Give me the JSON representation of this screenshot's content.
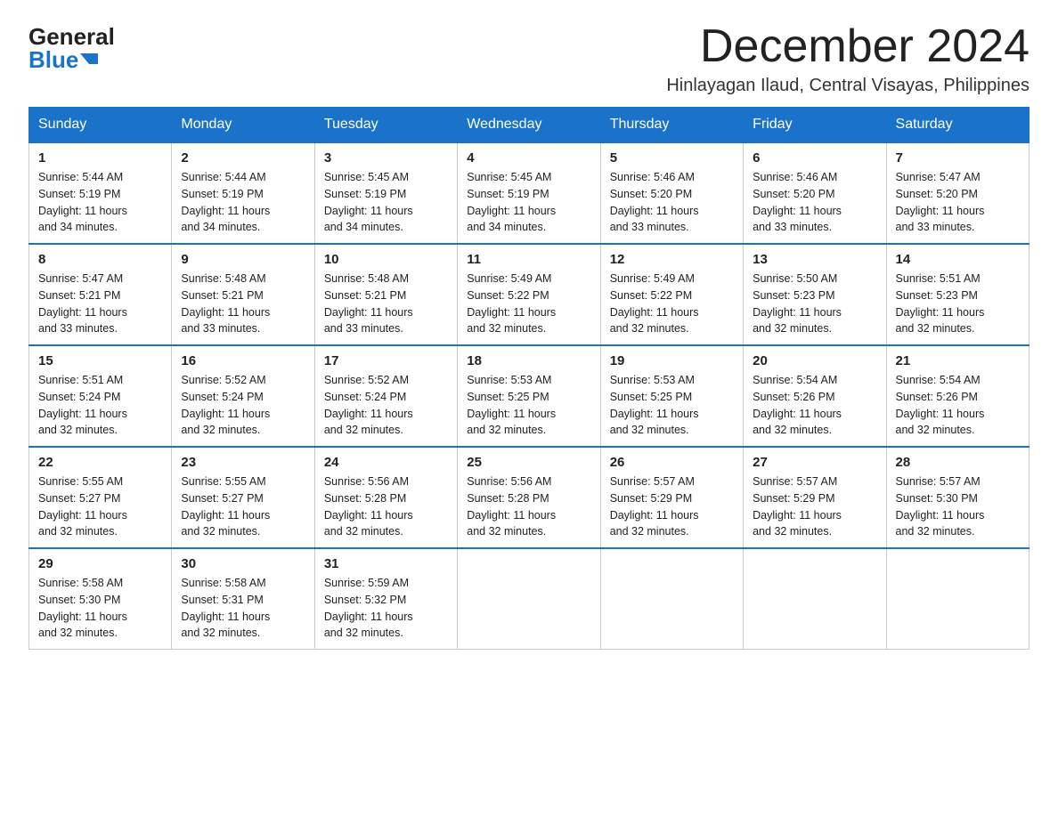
{
  "logo": {
    "general": "General",
    "blue": "Blue"
  },
  "title": "December 2024",
  "subtitle": "Hinlayagan Ilaud, Central Visayas, Philippines",
  "days_of_week": [
    "Sunday",
    "Monday",
    "Tuesday",
    "Wednesday",
    "Thursday",
    "Friday",
    "Saturday"
  ],
  "weeks": [
    [
      {
        "day": "1",
        "sunrise": "5:44 AM",
        "sunset": "5:19 PM",
        "daylight": "11 hours and 34 minutes."
      },
      {
        "day": "2",
        "sunrise": "5:44 AM",
        "sunset": "5:19 PM",
        "daylight": "11 hours and 34 minutes."
      },
      {
        "day": "3",
        "sunrise": "5:45 AM",
        "sunset": "5:19 PM",
        "daylight": "11 hours and 34 minutes."
      },
      {
        "day": "4",
        "sunrise": "5:45 AM",
        "sunset": "5:19 PM",
        "daylight": "11 hours and 34 minutes."
      },
      {
        "day": "5",
        "sunrise": "5:46 AM",
        "sunset": "5:20 PM",
        "daylight": "11 hours and 33 minutes."
      },
      {
        "day": "6",
        "sunrise": "5:46 AM",
        "sunset": "5:20 PM",
        "daylight": "11 hours and 33 minutes."
      },
      {
        "day": "7",
        "sunrise": "5:47 AM",
        "sunset": "5:20 PM",
        "daylight": "11 hours and 33 minutes."
      }
    ],
    [
      {
        "day": "8",
        "sunrise": "5:47 AM",
        "sunset": "5:21 PM",
        "daylight": "11 hours and 33 minutes."
      },
      {
        "day": "9",
        "sunrise": "5:48 AM",
        "sunset": "5:21 PM",
        "daylight": "11 hours and 33 minutes."
      },
      {
        "day": "10",
        "sunrise": "5:48 AM",
        "sunset": "5:21 PM",
        "daylight": "11 hours and 33 minutes."
      },
      {
        "day": "11",
        "sunrise": "5:49 AM",
        "sunset": "5:22 PM",
        "daylight": "11 hours and 32 minutes."
      },
      {
        "day": "12",
        "sunrise": "5:49 AM",
        "sunset": "5:22 PM",
        "daylight": "11 hours and 32 minutes."
      },
      {
        "day": "13",
        "sunrise": "5:50 AM",
        "sunset": "5:23 PM",
        "daylight": "11 hours and 32 minutes."
      },
      {
        "day": "14",
        "sunrise": "5:51 AM",
        "sunset": "5:23 PM",
        "daylight": "11 hours and 32 minutes."
      }
    ],
    [
      {
        "day": "15",
        "sunrise": "5:51 AM",
        "sunset": "5:24 PM",
        "daylight": "11 hours and 32 minutes."
      },
      {
        "day": "16",
        "sunrise": "5:52 AM",
        "sunset": "5:24 PM",
        "daylight": "11 hours and 32 minutes."
      },
      {
        "day": "17",
        "sunrise": "5:52 AM",
        "sunset": "5:24 PM",
        "daylight": "11 hours and 32 minutes."
      },
      {
        "day": "18",
        "sunrise": "5:53 AM",
        "sunset": "5:25 PM",
        "daylight": "11 hours and 32 minutes."
      },
      {
        "day": "19",
        "sunrise": "5:53 AM",
        "sunset": "5:25 PM",
        "daylight": "11 hours and 32 minutes."
      },
      {
        "day": "20",
        "sunrise": "5:54 AM",
        "sunset": "5:26 PM",
        "daylight": "11 hours and 32 minutes."
      },
      {
        "day": "21",
        "sunrise": "5:54 AM",
        "sunset": "5:26 PM",
        "daylight": "11 hours and 32 minutes."
      }
    ],
    [
      {
        "day": "22",
        "sunrise": "5:55 AM",
        "sunset": "5:27 PM",
        "daylight": "11 hours and 32 minutes."
      },
      {
        "day": "23",
        "sunrise": "5:55 AM",
        "sunset": "5:27 PM",
        "daylight": "11 hours and 32 minutes."
      },
      {
        "day": "24",
        "sunrise": "5:56 AM",
        "sunset": "5:28 PM",
        "daylight": "11 hours and 32 minutes."
      },
      {
        "day": "25",
        "sunrise": "5:56 AM",
        "sunset": "5:28 PM",
        "daylight": "11 hours and 32 minutes."
      },
      {
        "day": "26",
        "sunrise": "5:57 AM",
        "sunset": "5:29 PM",
        "daylight": "11 hours and 32 minutes."
      },
      {
        "day": "27",
        "sunrise": "5:57 AM",
        "sunset": "5:29 PM",
        "daylight": "11 hours and 32 minutes."
      },
      {
        "day": "28",
        "sunrise": "5:57 AM",
        "sunset": "5:30 PM",
        "daylight": "11 hours and 32 minutes."
      }
    ],
    [
      {
        "day": "29",
        "sunrise": "5:58 AM",
        "sunset": "5:30 PM",
        "daylight": "11 hours and 32 minutes."
      },
      {
        "day": "30",
        "sunrise": "5:58 AM",
        "sunset": "5:31 PM",
        "daylight": "11 hours and 32 minutes."
      },
      {
        "day": "31",
        "sunrise": "5:59 AM",
        "sunset": "5:32 PM",
        "daylight": "11 hours and 32 minutes."
      },
      null,
      null,
      null,
      null
    ]
  ],
  "labels": {
    "sunrise": "Sunrise:",
    "sunset": "Sunset:",
    "daylight": "Daylight:"
  }
}
